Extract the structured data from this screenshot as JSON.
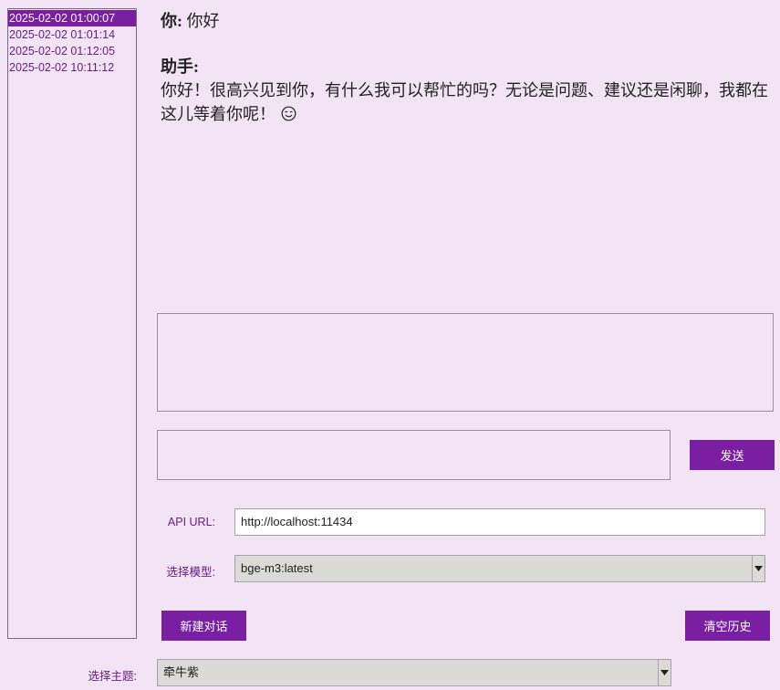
{
  "history": {
    "items": [
      {
        "label": "2025-02-02 01:00:07",
        "selected": true
      },
      {
        "label": "2025-02-02 01:01:14",
        "selected": false
      },
      {
        "label": "2025-02-02 01:12:05",
        "selected": false
      },
      {
        "label": "2025-02-02 10:11:12",
        "selected": false
      }
    ]
  },
  "chat": {
    "user_label": "你:",
    "user_text": "你好",
    "assistant_label": "助手:",
    "assistant_text": "你好！很高兴见到你，有什么我可以帮忙的吗？无论是问题、建议还是闲聊，我都在这儿等着你呢！",
    "emoji_icon": "smiling-face-icon"
  },
  "input": {
    "message_value": "",
    "send_label": "发送"
  },
  "settings": {
    "api_url_label": "API URL:",
    "api_url_value": "http://localhost:11434",
    "model_label": "选择模型:",
    "model_value": "bge-m3:latest",
    "theme_label": "选择主题:",
    "theme_value": "牵牛紫"
  },
  "actions": {
    "new_chat_label": "新建对话",
    "clear_history_label": "清空历史"
  },
  "colors": {
    "background": "#f2e3f5",
    "accent": "#7b1fa2",
    "text_purple": "#6a1d86"
  }
}
